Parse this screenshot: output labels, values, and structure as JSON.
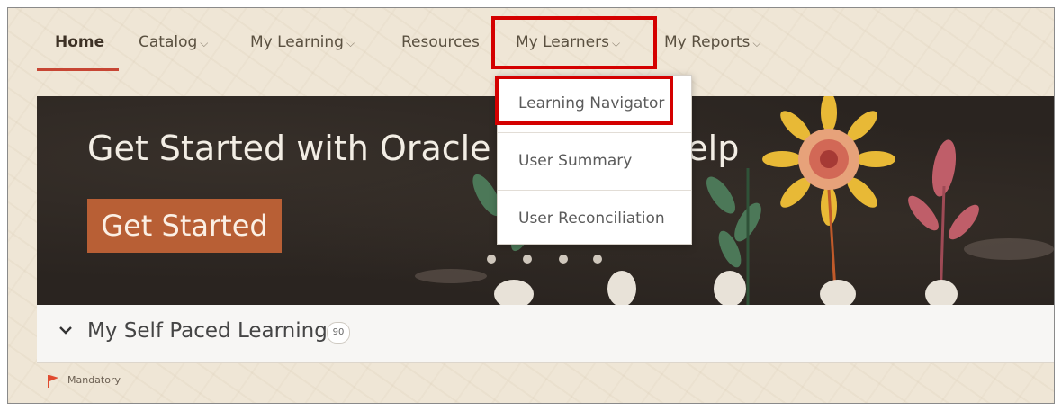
{
  "nav": {
    "items": [
      {
        "label": "Home",
        "has_chevron": false,
        "active": true
      },
      {
        "label": "Catalog",
        "has_chevron": true
      },
      {
        "label": "My Learning",
        "has_chevron": true
      },
      {
        "label": "Resources",
        "has_chevron": false
      },
      {
        "label": "My Learners",
        "has_chevron": true
      },
      {
        "label": "My Reports",
        "has_chevron": true
      }
    ],
    "chevron_glyph": "⌵",
    "accent_color": "#c74634"
  },
  "hero": {
    "title": "Get Started with Oracle Learning Help",
    "button_label": "Get Started",
    "button_color": "#b85f35"
  },
  "dropdown": {
    "items": [
      {
        "label": "Learning Navigator",
        "highlighted": true
      },
      {
        "label": "User Summary"
      },
      {
        "label": "User Reconciliation"
      }
    ]
  },
  "panel": {
    "title": "My Self Paced Learning",
    "badge": "90"
  },
  "legend": {
    "mandatory_label": "Mandatory",
    "flag_color": "#e04a2f"
  },
  "annotations": {
    "highlight_color": "#d40000"
  }
}
